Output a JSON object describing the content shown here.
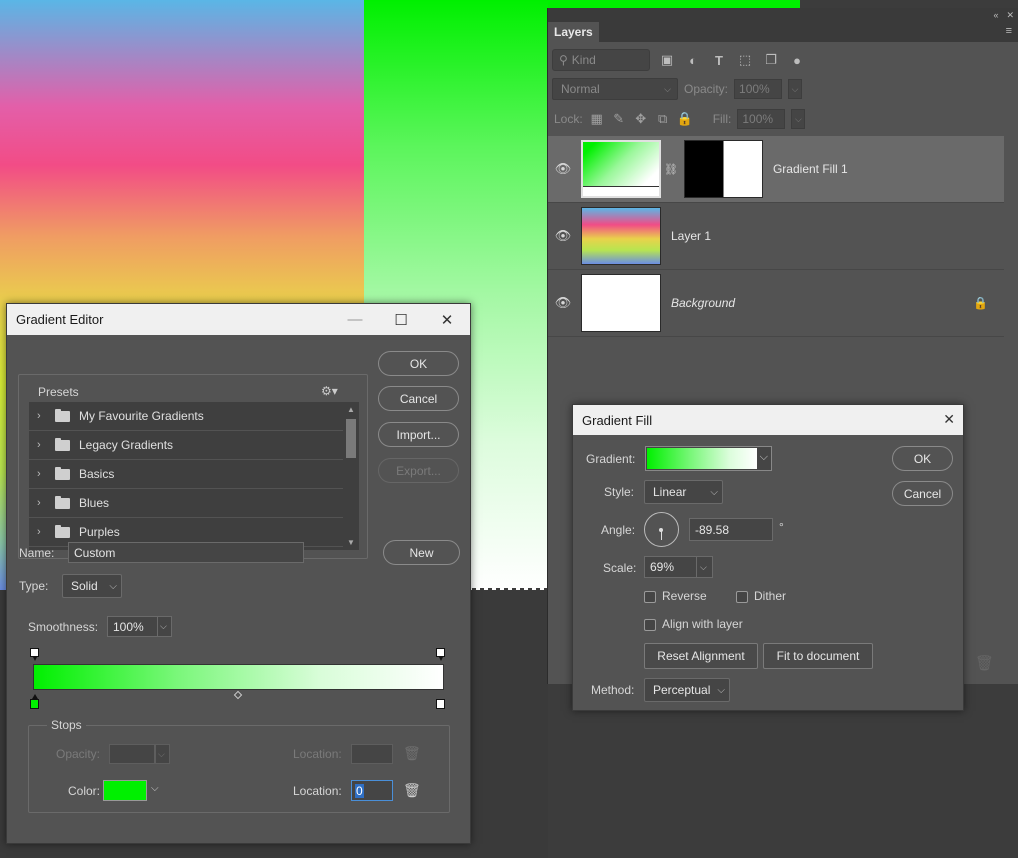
{
  "layers_panel": {
    "tab": "Layers",
    "kind_label": "Kind",
    "blend_mode": "Normal",
    "opacity_label": "Opacity:",
    "opacity_value": "100%",
    "lock_label": "Lock:",
    "fill_label": "Fill:",
    "fill_value": "100%",
    "layers": [
      {
        "name": "Gradient Fill 1"
      },
      {
        "name": "Layer 1"
      },
      {
        "name": "Background"
      }
    ]
  },
  "gradient_editor": {
    "title": "Gradient Editor",
    "presets_label": "Presets",
    "preset_folders": [
      "My Favourite Gradients",
      "Legacy Gradients",
      "Basics",
      "Blues",
      "Purples"
    ],
    "buttons": {
      "ok": "OK",
      "cancel": "Cancel",
      "import": "Import...",
      "export": "Export...",
      "new": "New"
    },
    "name_label": "Name:",
    "name_value": "Custom",
    "type_label": "Type:",
    "type_value": "Solid",
    "smoothness_label": "Smoothness:",
    "smoothness_value": "100%",
    "stops_label": "Stops",
    "opacity_label": "Opacity:",
    "color_label": "Color:",
    "location_label": "Location:",
    "location_value": "0",
    "stop_color": "#00f000"
  },
  "gradient_fill": {
    "title": "Gradient Fill",
    "gradient_label": "Gradient:",
    "style_label": "Style:",
    "style_value": "Linear",
    "angle_label": "Angle:",
    "angle_value": "-89.58",
    "degree_symbol": "°",
    "scale_label": "Scale:",
    "scale_value": "69%",
    "reverse_label": "Reverse",
    "dither_label": "Dither",
    "align_label": "Align with layer",
    "reset_alignment": "Reset Alignment",
    "fit_to_document": "Fit to document",
    "method_label": "Method:",
    "method_value": "Perceptual",
    "ok": "OK",
    "cancel": "Cancel"
  },
  "colors": {
    "panel_bg": "#535353",
    "title_bar": "#f0f0f0",
    "gradient_start": "#00f000",
    "gradient_end": "#ffffff"
  }
}
